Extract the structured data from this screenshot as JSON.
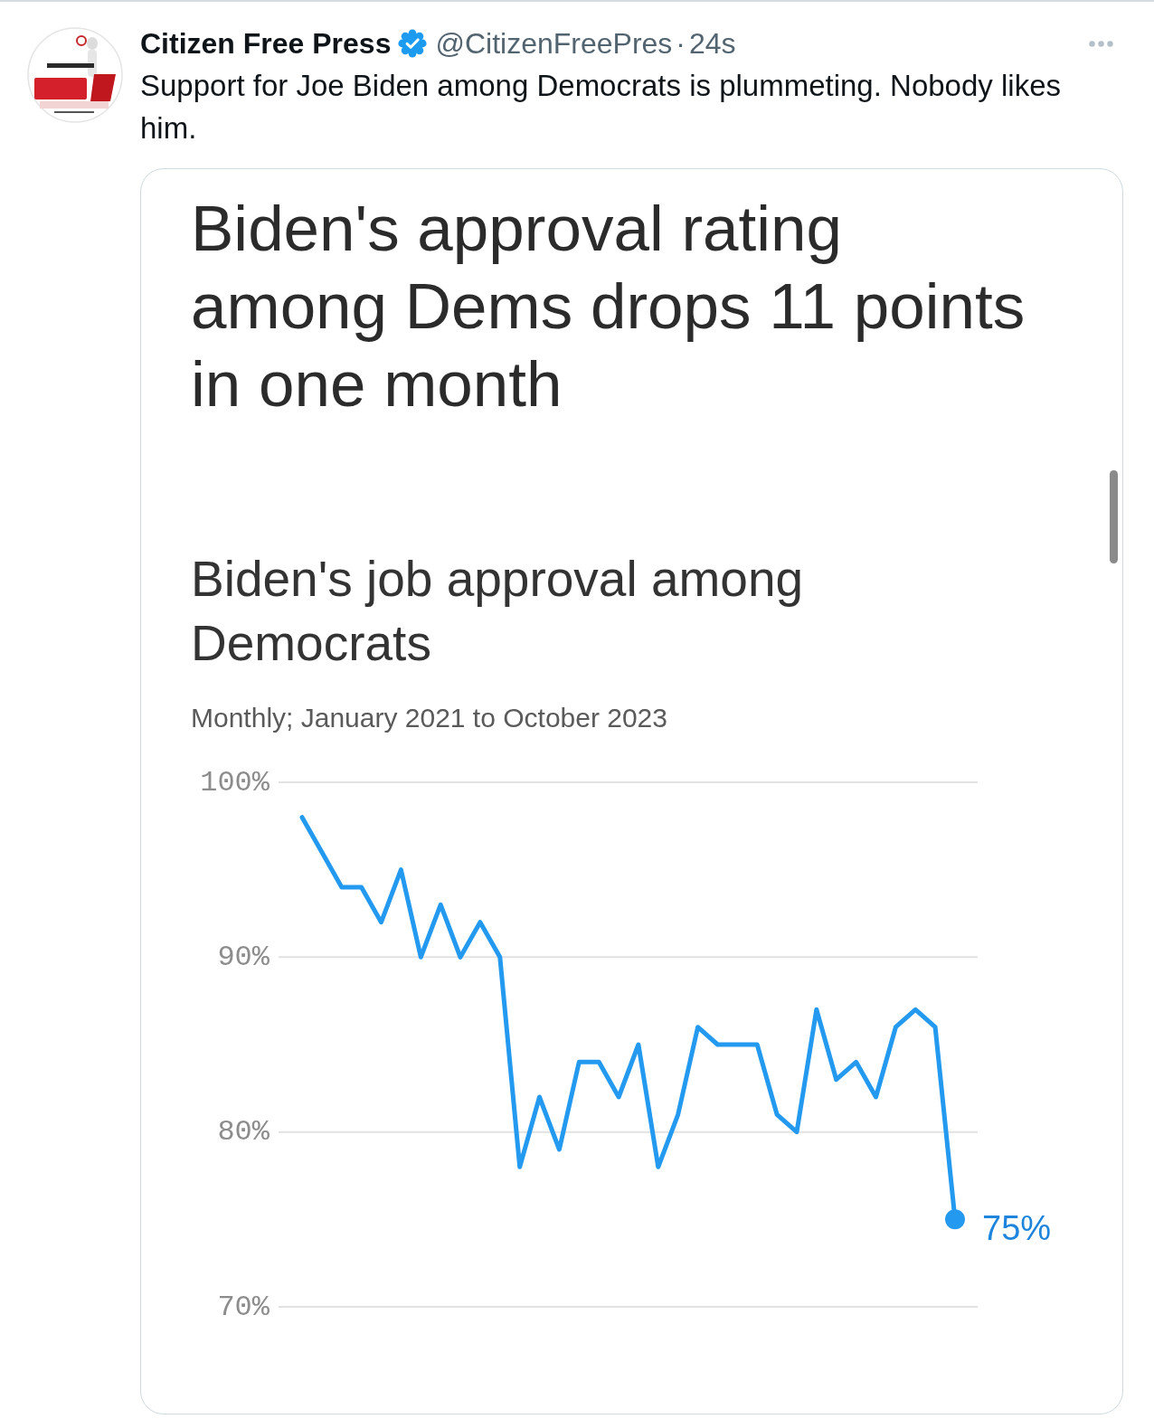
{
  "tweet": {
    "author": {
      "name": "Citizen Free Press",
      "verified": true,
      "handle": "@CitizenFreePres",
      "separator": "·",
      "time": "24s"
    },
    "text": "Support for Joe Biden among Democrats is plummeting. Nobody likes him.",
    "media": {
      "headline": "Biden's approval rating among Dems drops 11 points in one month",
      "subtitle": "Monthly; January 2021 to October 2023",
      "chart_data": {
        "type": "line",
        "title": "Biden's job approval among Democrats",
        "ylim": [
          70,
          100
        ],
        "yticks": [
          {
            "value": 100,
            "label": "100%"
          },
          {
            "value": 90,
            "label": "90%"
          },
          {
            "value": 80,
            "label": "80%"
          },
          {
            "value": 70,
            "label": "70%"
          }
        ],
        "series": [
          {
            "color": "#2399f0",
            "values": [
              98,
              96,
              94,
              94,
              92,
              95,
              90,
              93,
              90,
              92,
              90,
              78,
              82,
              79,
              84,
              84,
              82,
              85,
              78,
              81,
              86,
              85,
              85,
              85,
              81,
              80,
              87,
              83,
              84,
              82,
              86,
              87,
              86,
              75
            ]
          }
        ],
        "annotations": [
          {
            "text": "75%"
          }
        ]
      }
    }
  }
}
